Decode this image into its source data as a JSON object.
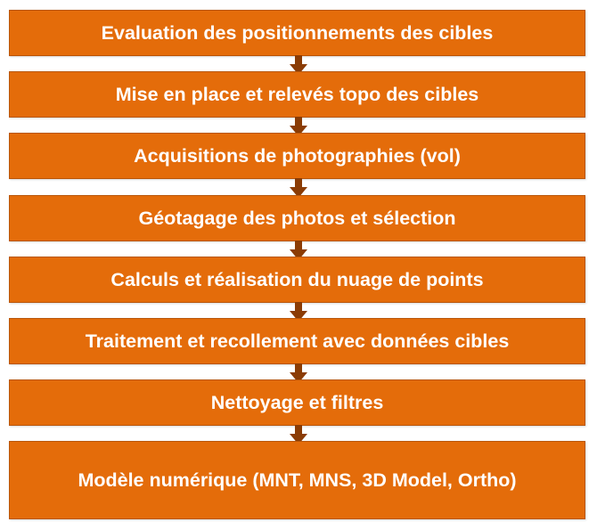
{
  "steps": [
    {
      "label": "Evaluation des positionnements des cibles"
    },
    {
      "label": "Mise en place et relevés topo des cibles"
    },
    {
      "label": "Acquisitions de photographies (vol)"
    },
    {
      "label": "Géotagage des photos et sélection"
    },
    {
      "label": "Calculs et réalisation du nuage de points"
    },
    {
      "label": "Traitement et recollement avec données cibles"
    },
    {
      "label": "Nettoyage et filtres"
    },
    {
      "label": "Modèle numérique (MNT, MNS, 3D Model, Ortho)"
    }
  ],
  "colors": {
    "box_fill": "#e46c0a",
    "box_border": "#b9560a",
    "arrow": "#8b3c05",
    "text": "#ffffff"
  }
}
